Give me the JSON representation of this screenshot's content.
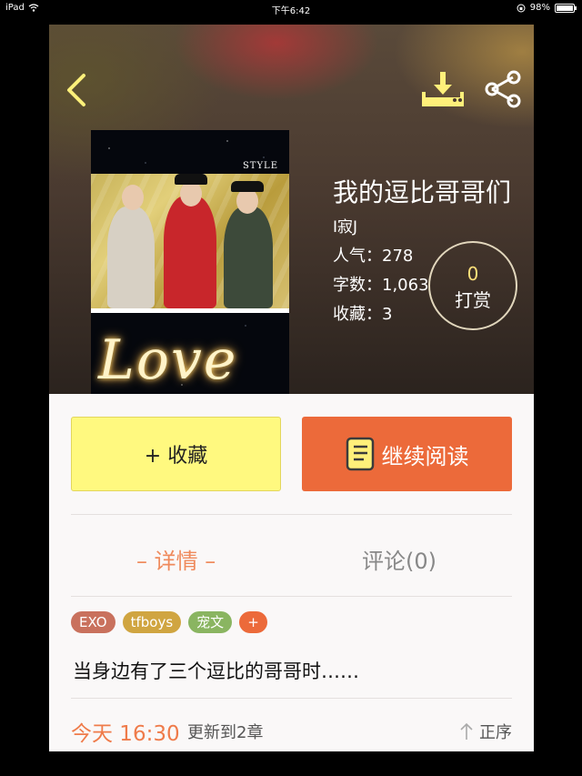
{
  "status_bar": {
    "device": "iPad",
    "time": "下午6:42",
    "battery": "98%"
  },
  "book": {
    "title": "我的逗比哥哥们",
    "author": "I寂J",
    "cover_style_text": "STYLE",
    "cover_love_text": "Love",
    "stats": [
      {
        "label": "人气：",
        "value": "278"
      },
      {
        "label": "字数：",
        "value": "1,063"
      },
      {
        "label": "收藏：",
        "value": "3"
      }
    ],
    "reward": {
      "count": "0",
      "label": "打赏"
    }
  },
  "actions": {
    "favorite_label": "+ 收藏",
    "continue_label": "继续阅读"
  },
  "tabs": {
    "details": "– 详情 –",
    "comments": "评论(0)"
  },
  "tags": [
    {
      "text": "EXO",
      "color": "#c9715d"
    },
    {
      "text": "tfboys",
      "color": "#d0a541"
    },
    {
      "text": "宠文",
      "color": "#8ab561"
    },
    {
      "text": "+",
      "color": "#ec6a3a"
    }
  ],
  "description": "当身边有了三个逗比的哥哥时……",
  "footer": {
    "time": "今天 16:30",
    "update": "更新到2章",
    "sort": "正序"
  },
  "colors": {
    "accent_orange": "#ec6a3a",
    "favorite_yellow": "#fff97f",
    "icon_yellow": "#fff07a"
  },
  "icons": [
    "back-icon",
    "download-icon",
    "share-icon",
    "book-icon",
    "sort-arrow-icon"
  ]
}
